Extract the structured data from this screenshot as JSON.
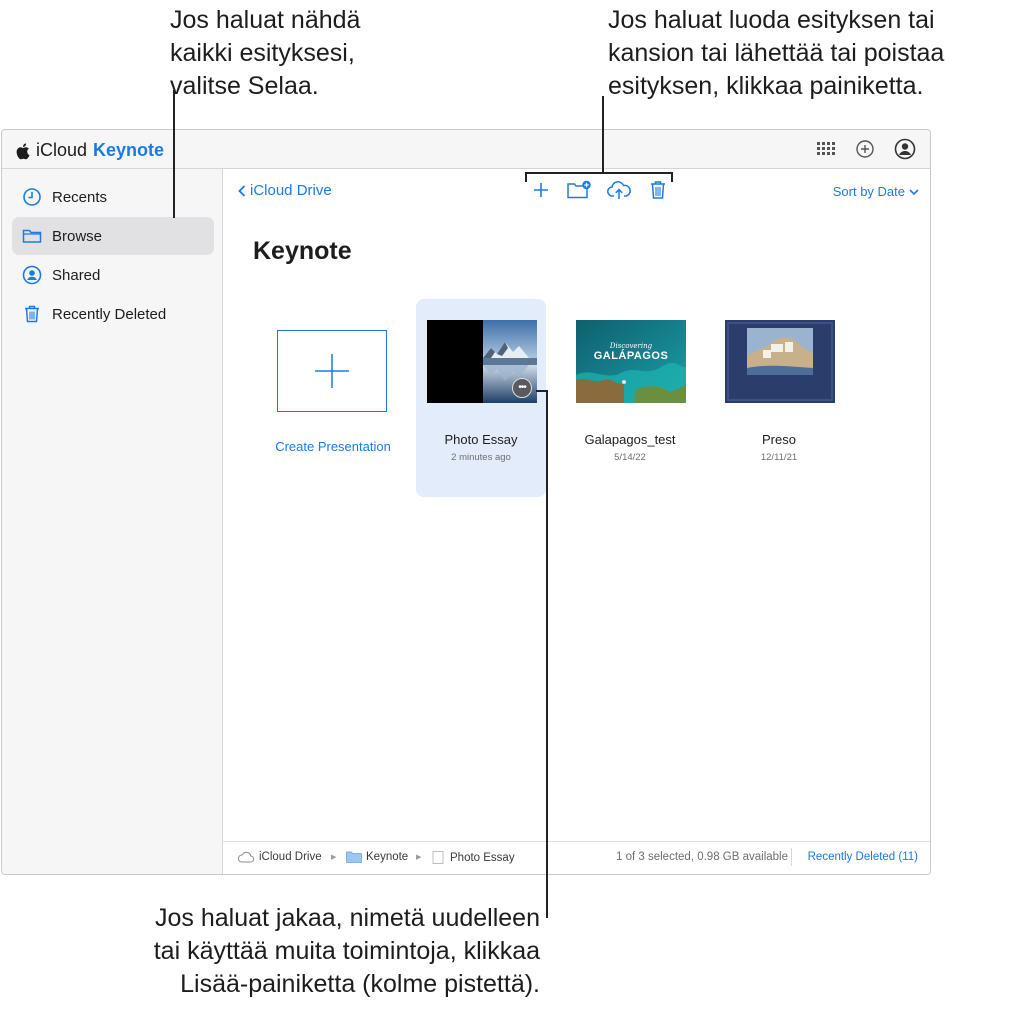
{
  "callouts": {
    "browse": "Jos haluat nähdä\nkaikki esityksesi,\nvalitse Selaa.",
    "toolbar": "Jos haluat luoda esityksen tai\nkansion tai lähettää tai poistaa\nesityksen, klikkaa painiketta.",
    "more": "Jos haluat jakaa, nimetä uudelleen\ntai käyttää muita toimintoja, klikkaa\nLisää-painiketta (kolme pistettä)."
  },
  "header": {
    "brand": "iCloud",
    "app_name": "Keynote",
    "icons": [
      "app-grid-icon",
      "add-circle-icon",
      "account-icon"
    ]
  },
  "sidebar": {
    "items": [
      {
        "label": "Recents",
        "icon": "clock-icon",
        "active": false
      },
      {
        "label": "Browse",
        "icon": "folder-icon",
        "active": true
      },
      {
        "label": "Shared",
        "icon": "shared-person-icon",
        "active": false
      },
      {
        "label": "Recently Deleted",
        "icon": "trash-icon",
        "active": false
      }
    ]
  },
  "main": {
    "back_label": "iCloud Drive",
    "sort_label": "Sort by Date",
    "toolbar_icons": [
      "plus-icon",
      "new-folder-icon",
      "upload-icon",
      "trash-icon"
    ],
    "title": "Keynote",
    "create_label": "Create Presentation",
    "documents": [
      {
        "name": "Photo Essay",
        "date": "2 minutes ago",
        "selected": true
      },
      {
        "name": "Galapagos_test",
        "date": "5/14/22",
        "selected": false,
        "thumb_text_small": "Discovering",
        "thumb_text_big": "GALÁPAGOS"
      },
      {
        "name": "Preso",
        "date": "12/11/21",
        "selected": false
      }
    ]
  },
  "status_bar": {
    "crumbs": [
      "iCloud Drive",
      "Keynote",
      "Photo Essay"
    ],
    "status_text": "1 of 3 selected, 0.98 GB available",
    "recently_deleted_link": "Recently Deleted (11)"
  },
  "colors": {
    "accent": "#1b7ae6",
    "selected_card": "#e3ecfb",
    "sidebar_bg": "#f6f6f6"
  }
}
